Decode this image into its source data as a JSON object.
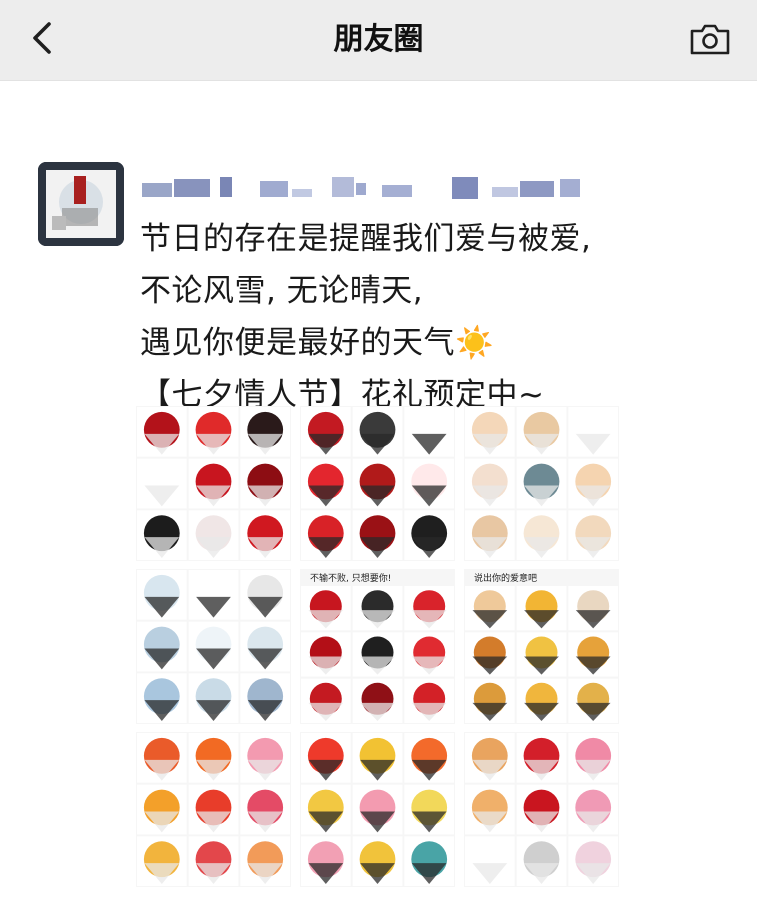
{
  "header": {
    "title": "朋友圈",
    "back_icon": "chevron-left-icon",
    "camera_icon": "camera-icon"
  },
  "post": {
    "avatar_icon": "avatar-icon",
    "username_blurred": true,
    "text_lines": [
      "节日的存在是提醒我们爱与被爱,",
      "不论风雪, 无论晴天,",
      "遇见你便是最好的天气☀️",
      "【七夕情人节】花礼预定中~"
    ],
    "photos": [
      {
        "theme": "red-roses",
        "palette": [
          "#b3121a",
          "#e02a2a",
          "#2a1a1a",
          "#ffffff",
          "#c8151f",
          "#8d0d13",
          "#1c1c1c",
          "#f0e6e6",
          "#d01820"
        ]
      },
      {
        "theme": "red-roses-mixed",
        "palette": [
          "#c31a22",
          "#3a3a3a",
          "#ffffff",
          "#e3262e",
          "#b11a1a",
          "#ffe9ea",
          "#d82227",
          "#9a1115",
          "#1f1f1f"
        ]
      },
      {
        "theme": "champagne-roses",
        "palette": [
          "#f4d7b9",
          "#e9c9a2",
          "#ffffff",
          "#f3dfcf",
          "#6d8a94",
          "#f5d4b0",
          "#e8c7a3",
          "#f6e7d5",
          "#f2d9bd"
        ]
      },
      {
        "theme": "blue-white-bouquets",
        "palette": [
          "#d8e6ef",
          "#ffffff",
          "#e7e7e7",
          "#b9cfe0",
          "#eef4f8",
          "#dbe7ee",
          "#a9c6de",
          "#c9dbe7",
          "#9fb6ce"
        ]
      },
      {
        "theme": "red-roses-bouquets",
        "caption": "不输不败, 只想要你!",
        "palette": [
          "#c7161f",
          "#2b2b2b",
          "#d9232b",
          "#b30f17",
          "#1f1f1f",
          "#e02b31",
          "#c41a21",
          "#8f1016",
          "#d32127"
        ]
      },
      {
        "theme": "sunflower-bouquets",
        "caption": "说出你的爱意吧",
        "palette": [
          "#efc99a",
          "#f2b534",
          "#e9d7c1",
          "#d37c2b",
          "#f0c242",
          "#e6a23a",
          "#dc9b3b",
          "#f0b63d",
          "#e3b14a"
        ]
      },
      {
        "theme": "mixed-bouquets",
        "palette": [
          "#ea5b2a",
          "#f26a23",
          "#f39ab0",
          "#f3a02a",
          "#e83d2a",
          "#e44b66",
          "#f2b43d",
          "#e3474b",
          "#f29b59"
        ]
      },
      {
        "theme": "sunflower-mixed",
        "palette": [
          "#ee3a2b",
          "#f2c233",
          "#f36a2b",
          "#f2c842",
          "#f39bb0",
          "#f2d85a",
          "#f2a0b4",
          "#f1c33b",
          "#49a4a6"
        ]
      },
      {
        "theme": "boxed-roses",
        "palette": [
          "#e9a45f",
          "#d31f2a",
          "#f08aa6",
          "#f0b06a",
          "#c9151f",
          "#f09ab5",
          "#ffffff",
          "#cfcfcf",
          "#f0d2de"
        ]
      }
    ]
  },
  "colors": {
    "header_bg": "#ededed",
    "text": "#1a1a1a",
    "page_bg": "#ffffff"
  }
}
